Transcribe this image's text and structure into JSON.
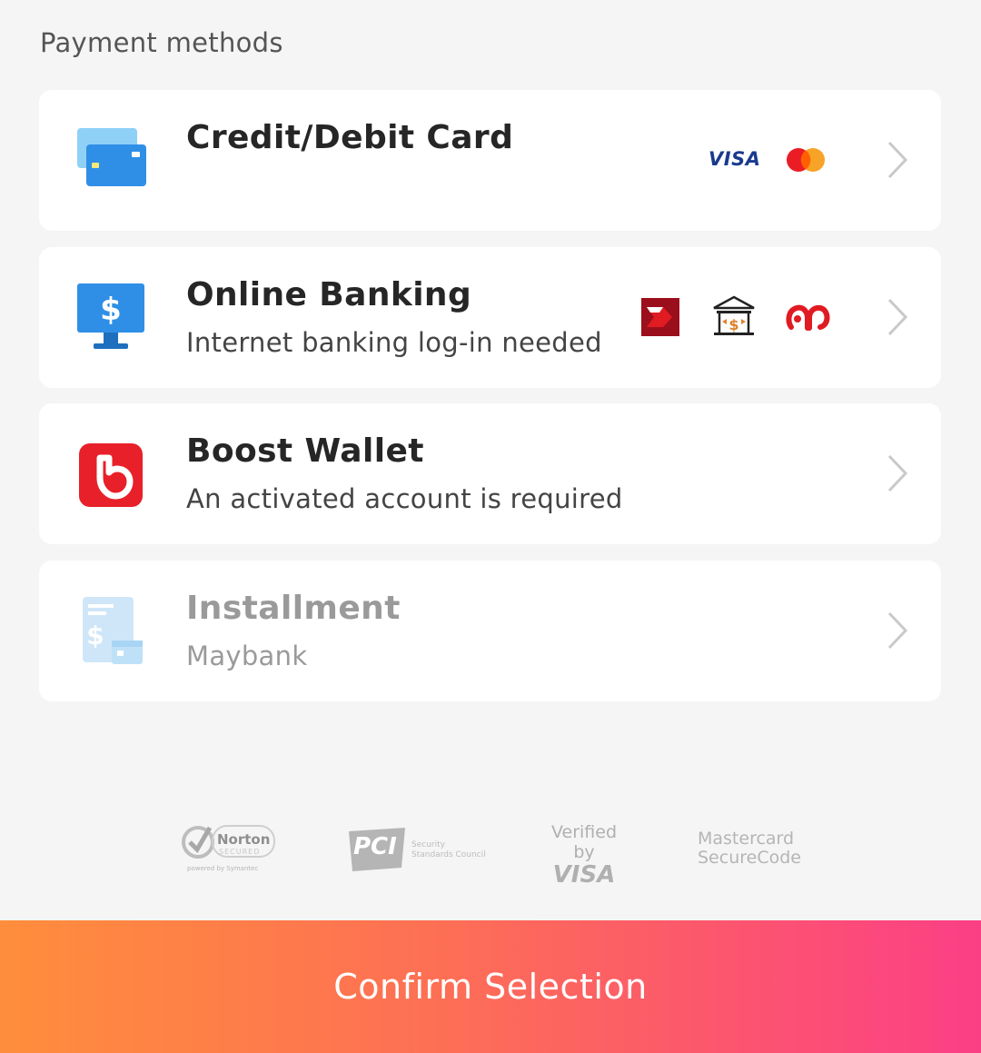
{
  "header": {
    "title": "Payment methods"
  },
  "methods": [
    {
      "title": "Credit/Debit Card",
      "subtitle": "",
      "logos": [
        "visa-logo",
        "mastercard-logo"
      ],
      "enabled": true
    },
    {
      "title": "Online Banking",
      "subtitle": "Internet banking log-in needed",
      "logos": [
        "bank-red-logo",
        "bank-building-logo",
        "ambank-logo"
      ],
      "enabled": true
    },
    {
      "title": "Boost Wallet",
      "subtitle": "An activated account is required",
      "logos": [],
      "enabled": true
    },
    {
      "title": "Installment",
      "subtitle": "Maybank",
      "logos": [],
      "enabled": false
    }
  ],
  "logo_text": {
    "visa": "VISA"
  },
  "trust_badges": {
    "norton": {
      "main": "Norton",
      "sub": "SECURED",
      "powered": "powered by Symantec"
    },
    "pci": {
      "main": "PCI",
      "sub1": "Security",
      "sub2": "Standards Council"
    },
    "verified_visa": {
      "line1": "Verified by",
      "line2": "VISA"
    },
    "mastercard_securecode": {
      "line1": "Mastercard",
      "line2": "SecureCode"
    }
  },
  "footer": {
    "confirm_label": "Confirm Selection"
  },
  "colors": {
    "accent_start": "#ff8e3c",
    "accent_end": "#fb3f85",
    "card_icon_blue": "#2f8fe6",
    "boost_red": "#e8202a",
    "disabled_text": "#9a9a9a"
  }
}
